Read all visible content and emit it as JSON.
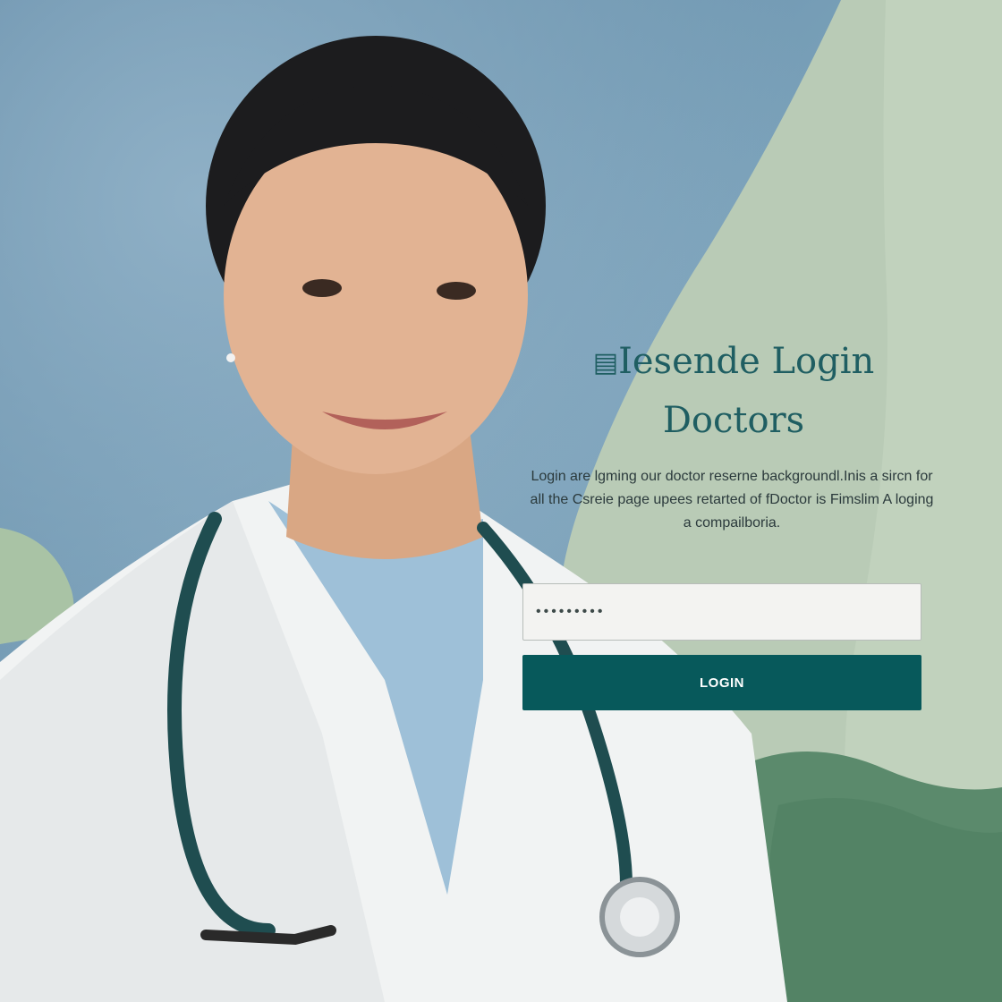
{
  "login_panel": {
    "title_line1": "Iesende Login",
    "title_line2": "Doctors",
    "description": "Login are lgming our doctor reserne backgroundl.Inis a sircn for all the Csreie page upees retarted of fDoctor is Fimslim A loging a compailboria.",
    "password_mask": "•••••••••",
    "login_button_label": "LOGIN"
  },
  "photo": {
    "subject": "smiling doctor in white coat with stethoscope"
  },
  "colors": {
    "brand_teal": "#07595b",
    "title_teal": "#1f5e62",
    "panel_sage": "#bccdb8",
    "dark_green": "#5f8a6d"
  }
}
